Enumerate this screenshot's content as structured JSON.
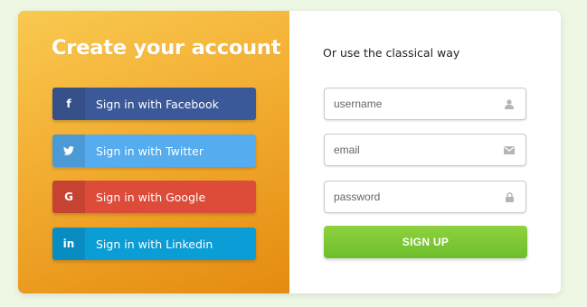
{
  "page": {
    "title": "Create your account",
    "alt_text": "Or use the classical way"
  },
  "social": [
    {
      "label": "Sign in with Facebook",
      "icon": "facebook-icon",
      "glyph": "f",
      "color": "#3b5898"
    },
    {
      "label": "Sign in with Twitter",
      "icon": "twitter-icon",
      "glyph": "",
      "color": "#55acee"
    },
    {
      "label": "Sign in with Google",
      "icon": "google-icon",
      "glyph": "G",
      "color": "#dd4b39"
    },
    {
      "label": "Sign in with Linkedin",
      "icon": "linkedin-icon",
      "glyph": "in",
      "color": "#0b9dd6"
    }
  ],
  "form": {
    "username_placeholder": "username",
    "email_placeholder": "email",
    "password_placeholder": "password",
    "signup_label": "SIGN UP"
  },
  "colors": {
    "panel_gradient": [
      "#f9c950",
      "#e48b10"
    ],
    "signup_green": "#7dc935",
    "background": "#eef7e4"
  }
}
